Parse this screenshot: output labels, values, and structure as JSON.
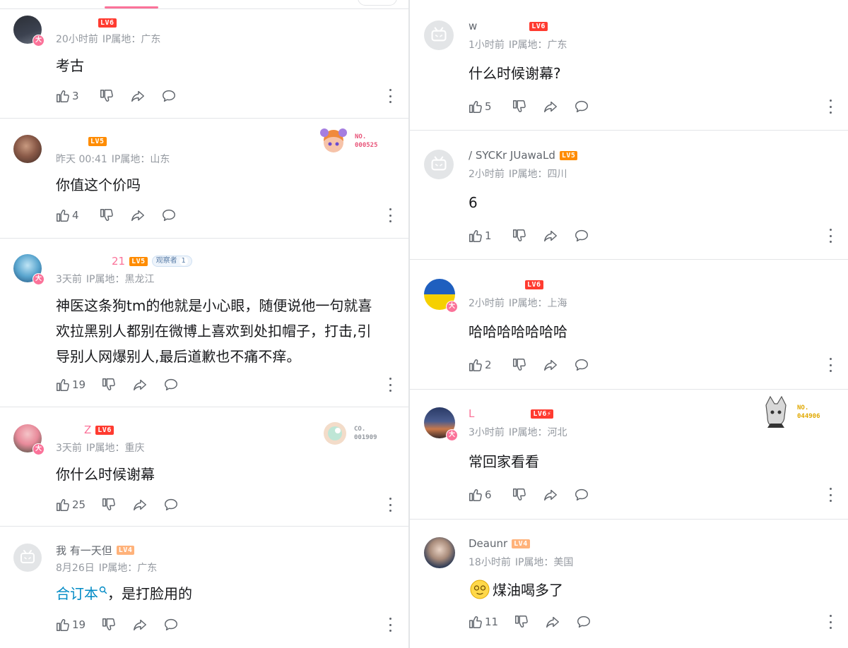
{
  "left": {
    "comments": [
      {
        "name": "",
        "level": "LV6",
        "time": "20小时前",
        "ip": "IP属地：广东",
        "text": "考古",
        "likes": "3"
      },
      {
        "name": "",
        "level": "LV5",
        "time": "昨天 00:41",
        "ip": "IP属地：山东",
        "text": "你值这个价吗",
        "likes": "4",
        "decor_no": "NO.\n000525"
      },
      {
        "name": "21",
        "level": "LV5",
        "observer": "观察者",
        "observer_count": "1",
        "time": "3天前",
        "ip": "IP属地：黑龙江",
        "text": "神医这条狗tm的他就是小心眼，随便说他一句就喜\n欢拉黑别人都别在微博上喜欢到处扣帽子，打击,引\n导别人网爆别人,最后道歉也不痛不痒。",
        "likes": "19"
      },
      {
        "name": "Z",
        "level": "LV6",
        "time": "3天前",
        "ip": "IP属地：重庆",
        "text": "你什么时候谢幕",
        "likes": "25",
        "decor_no": "CO.\n001909"
      },
      {
        "name": "我 有一天但",
        "level": "LV4",
        "time": "8月26日",
        "ip": "IP属地：广东",
        "link_text": "合订本",
        "text_after": "，是打脸用的",
        "likes": "19"
      }
    ]
  },
  "right": {
    "comments": [
      {
        "name": "w",
        "level": "LV6",
        "time": "1小时前",
        "ip": "IP属地：广东",
        "text": "什么时候谢幕?",
        "likes": "5"
      },
      {
        "name": "/ SYCKr JUawaLd",
        "level": "LV5",
        "time": "2小时前",
        "ip": "IP属地：四川",
        "text": "6",
        "likes": "1"
      },
      {
        "name": "",
        "level": "LV6",
        "time": "2小时前",
        "ip": "IP属地：上海",
        "text": "哈哈哈哈哈哈哈",
        "likes": "2"
      },
      {
        "name": "L",
        "level": "LV6⚡",
        "time": "3小时前",
        "ip": "IP属地：河北",
        "text": "常回家看看",
        "likes": "6",
        "decor_no": "NO.\n044906"
      },
      {
        "name": "Deaunr",
        "level": "LV4",
        "time": "18小时前",
        "ip": "IP属地：美国",
        "text": "煤油喝多了",
        "likes": "11"
      }
    ]
  },
  "colors": {
    "accent": "#fb7299",
    "level6": "#ff3b30",
    "level5": "#ff8c00",
    "level4": "#ffb27a",
    "link": "#008ac5",
    "meta": "#9499a0"
  }
}
